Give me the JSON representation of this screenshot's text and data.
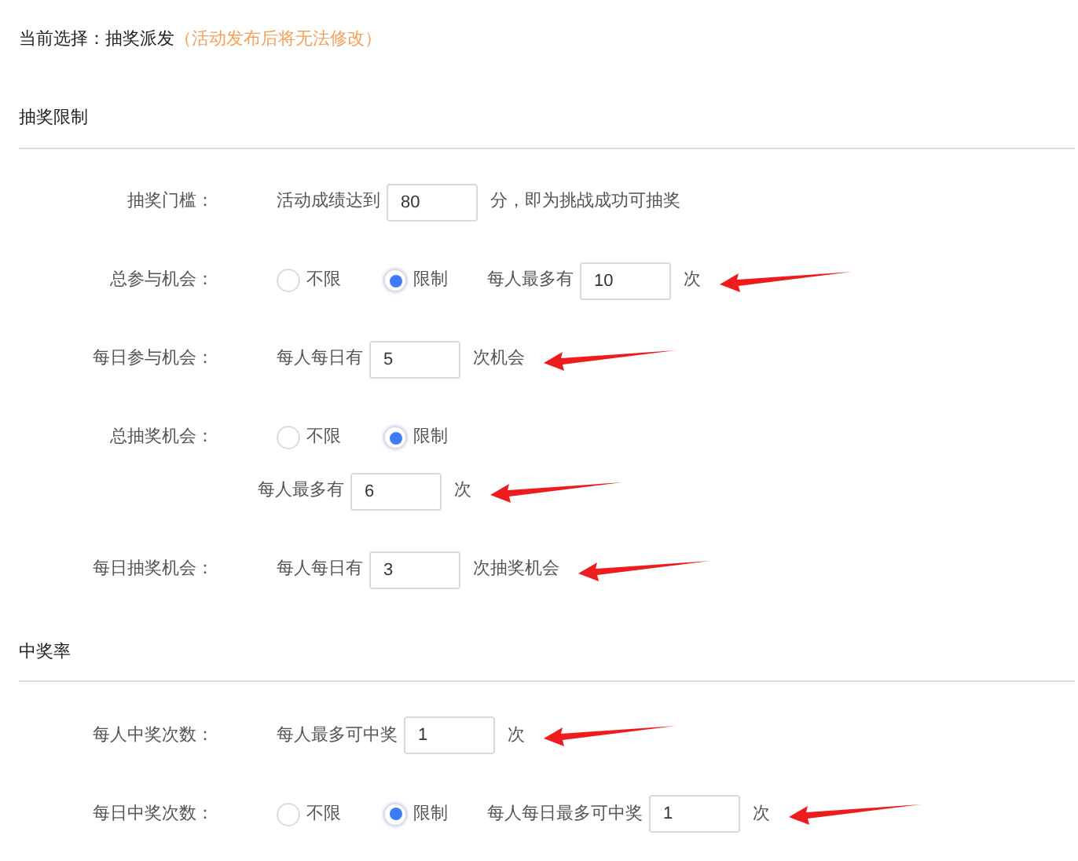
{
  "current_selection": {
    "label": "当前选择：抽奖派发",
    "note": "（活动发布后将无法修改）"
  },
  "sections": [
    {
      "title": "抽奖限制",
      "rows": [
        {
          "kind": "input",
          "label": "抽奖门槛：",
          "before": "活动成绩达到",
          "value": "80",
          "after": "分，即为挑战成功可抽奖",
          "arrow": false
        },
        {
          "kind": "radio_input",
          "label": "总参与机会：",
          "options": [
            {
              "label": "不限",
              "selected": false
            },
            {
              "label": "限制",
              "selected": true
            }
          ],
          "before": "每人最多有",
          "value": "10",
          "after": "次",
          "arrow": true
        },
        {
          "kind": "input",
          "label": "每日参与机会：",
          "before": "每人每日有",
          "value": "5",
          "after": "次机会",
          "arrow": true
        },
        {
          "kind": "radio_newline",
          "label": "总抽奖机会：",
          "options": [
            {
              "label": "不限",
              "selected": false
            },
            {
              "label": "限制",
              "selected": true
            }
          ],
          "before": "每人最多有",
          "value": "6",
          "after": "次",
          "arrow": true
        },
        {
          "kind": "input",
          "label": "每日抽奖机会：",
          "before": "每人每日有",
          "value": "3",
          "after": "次抽奖机会",
          "arrow": true
        }
      ]
    },
    {
      "title": "中奖率",
      "rows": [
        {
          "kind": "input",
          "label": "每人中奖次数：",
          "before": "每人最多可中奖",
          "value": "1",
          "after": "次",
          "arrow": true
        },
        {
          "kind": "radio_input",
          "label": "每日中奖次数：",
          "options": [
            {
              "label": "不限",
              "selected": false
            },
            {
              "label": "限制",
              "selected": true
            }
          ],
          "before": "每人每日最多可中奖",
          "value": "1",
          "after": "次",
          "arrow": true
        }
      ]
    }
  ]
}
